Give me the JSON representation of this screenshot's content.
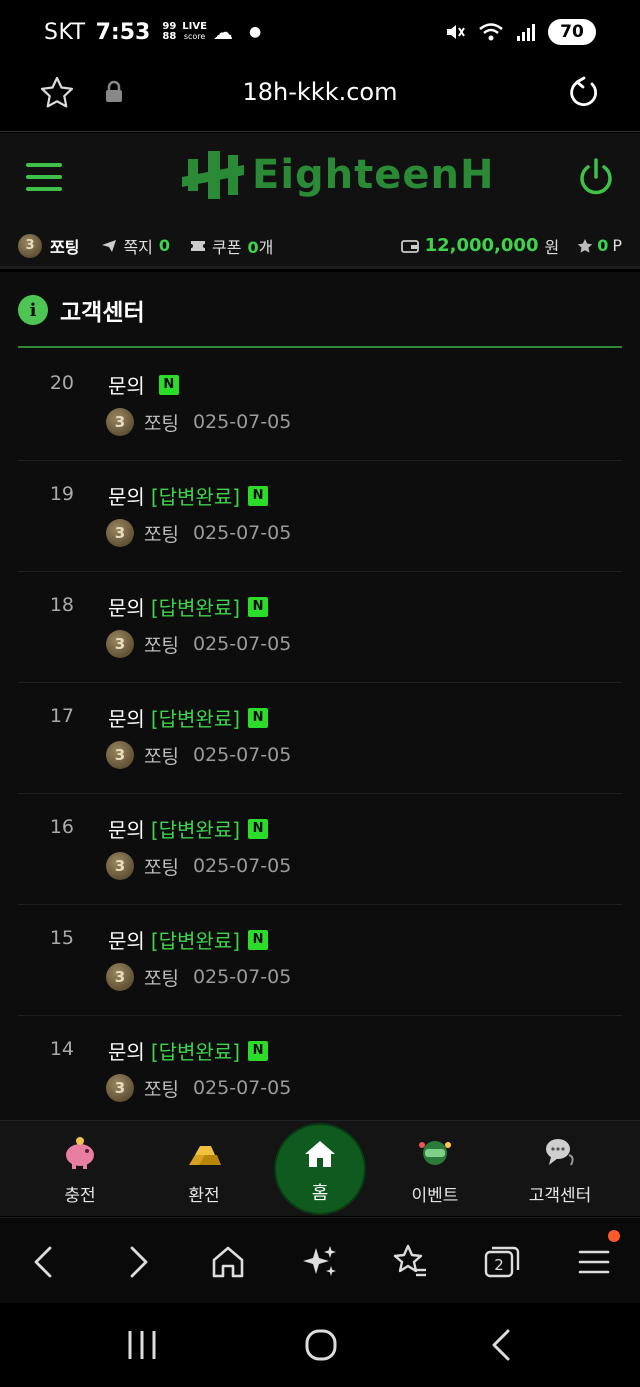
{
  "status_bar": {
    "carrier": "SKT",
    "time": "7:53",
    "mini_top": "99",
    "mini_bottom": "88",
    "live_top": "LIVE",
    "live_bottom": "score",
    "battery": "70"
  },
  "browser": {
    "url": "18h-kkk.com"
  },
  "site": {
    "logo_text": "EighteenH"
  },
  "user": {
    "level": "3",
    "nickname": "쪼팅",
    "messages_label": "쪽지",
    "messages_count": "0",
    "coupons_label": "쿠폰",
    "coupons_count": "0",
    "coupons_unit": "개",
    "balance": "12,000,000",
    "balance_unit": "원",
    "points": "0",
    "points_unit": "P"
  },
  "page": {
    "info_glyph": "i",
    "title": "고객센터"
  },
  "posts": [
    {
      "num": "20",
      "title": "문의",
      "status": "",
      "badge": "N",
      "level": "3",
      "author": "쪼팅",
      "date": "025-07-05"
    },
    {
      "num": "19",
      "title": "문의",
      "status": "[답변완료]",
      "badge": "N",
      "level": "3",
      "author": "쪼팅",
      "date": "025-07-05"
    },
    {
      "num": "18",
      "title": "문의",
      "status": "[답변완료]",
      "badge": "N",
      "level": "3",
      "author": "쪼팅",
      "date": "025-07-05"
    },
    {
      "num": "17",
      "title": "문의",
      "status": "[답변완료]",
      "badge": "N",
      "level": "3",
      "author": "쪼팅",
      "date": "025-07-05"
    },
    {
      "num": "16",
      "title": "문의",
      "status": "[답변완료]",
      "badge": "N",
      "level": "3",
      "author": "쪼팅",
      "date": "025-07-05"
    },
    {
      "num": "15",
      "title": "문의",
      "status": "[답변완료]",
      "badge": "N",
      "level": "3",
      "author": "쪼팅",
      "date": "025-07-05"
    },
    {
      "num": "14",
      "title": "문의",
      "status": "[답변완료]",
      "badge": "N",
      "level": "3",
      "author": "쪼팅",
      "date": "025-07-05"
    }
  ],
  "nav": {
    "deposit": "충전",
    "withdraw": "환전",
    "home": "홈",
    "event": "이벤트",
    "support": "고객센터"
  },
  "browser_toolbar": {
    "tabs_count": "2"
  },
  "colors": {
    "accent_green": "#3fd24c",
    "badge_green": "#2bdc2b",
    "home_circle": "#0f5a1f",
    "notification_dot": "#ff5a2a"
  }
}
